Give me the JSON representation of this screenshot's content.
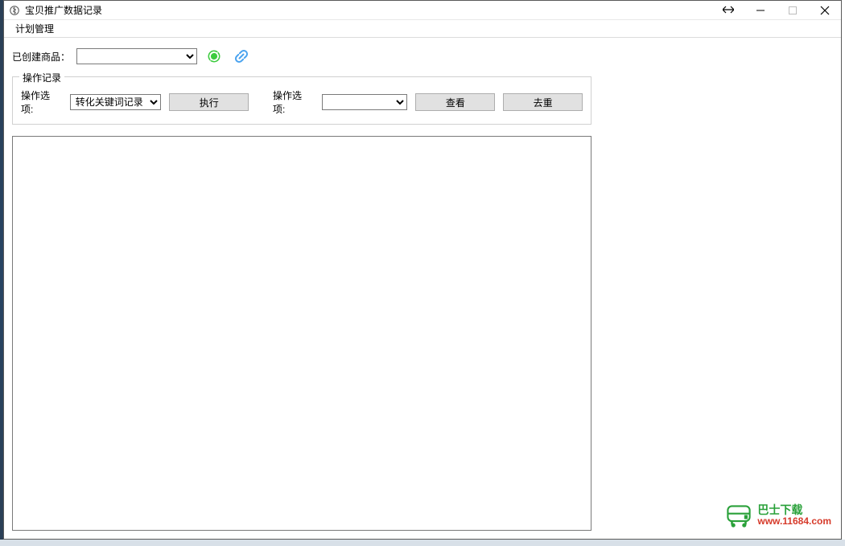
{
  "window": {
    "title": "宝贝推广数据记录"
  },
  "menubar": {
    "items": [
      "计划管理"
    ]
  },
  "toolbar": {
    "created_label": "已创建商品：",
    "product_value": "",
    "product_options": []
  },
  "group": {
    "title": "操作记录",
    "op_label_1": "操作选项:",
    "op1_value": "转化关键词记录",
    "execute_label": "执行",
    "op_label_2": "操作选项:",
    "op2_value": "",
    "view_label": "查看",
    "dedup_label": "去重"
  },
  "output": {
    "text": ""
  },
  "watermark": {
    "cn": "巴士下载",
    "url": "www.11684.com"
  }
}
